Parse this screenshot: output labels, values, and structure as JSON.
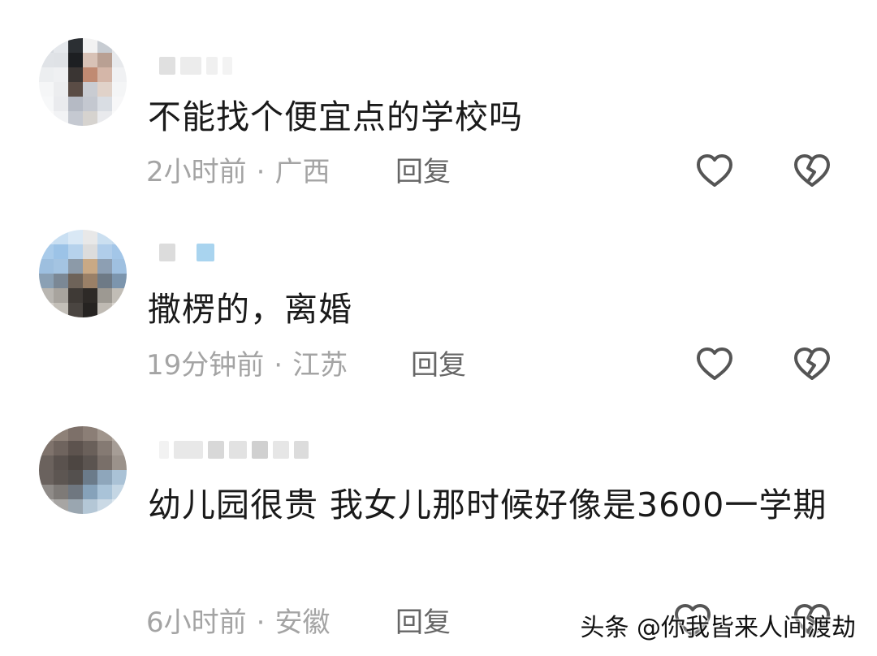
{
  "comments": [
    {
      "text": "不能找个便宜点的学校吗",
      "time": "2小时前",
      "location": "广西",
      "reply_label": "回复",
      "avatar_icon": "pixelated-avatar"
    },
    {
      "text": "撒楞的，离婚",
      "time": "19分钟前",
      "location": "江苏",
      "reply_label": "回复",
      "avatar_icon": "pixelated-avatar"
    },
    {
      "text": "幼儿园很贵   我女儿那时候好像是3600一学期",
      "time": "6小时前",
      "location": "安徽",
      "reply_label": "回复",
      "avatar_icon": "pixelated-avatar"
    }
  ],
  "meta_separator": "·",
  "icons": {
    "like": "heart-outline-icon",
    "dislike": "broken-heart-icon"
  },
  "colors": {
    "text": "#1a1a1a",
    "meta": "#a4a4a4",
    "icon": "#555555"
  },
  "watermark": "头条 @你我皆来人间渡劫"
}
